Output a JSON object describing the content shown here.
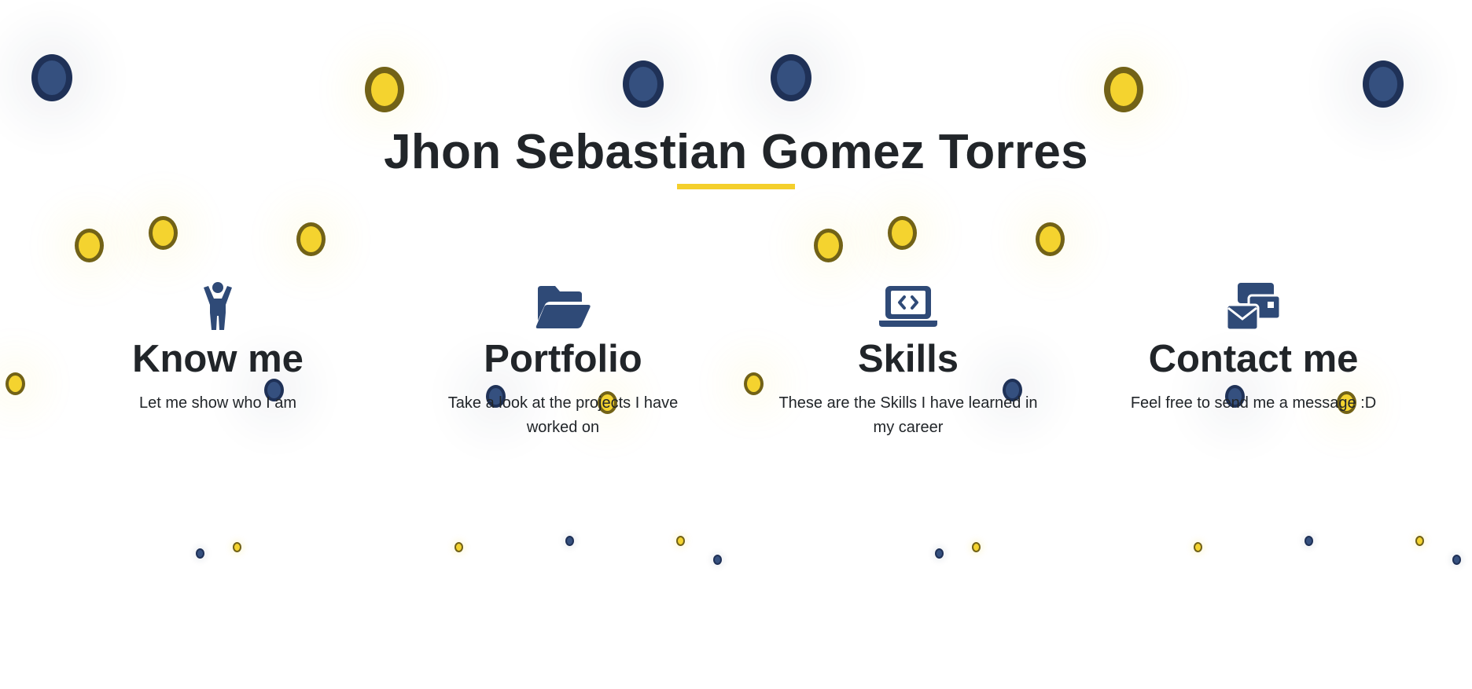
{
  "header": {
    "title": "Jhon Sebastian Gomez Torres"
  },
  "colors": {
    "accent": "#f4cf2c",
    "navy": "#2f4a77",
    "text": "#212529"
  },
  "sections": [
    {
      "icon": "person-icon",
      "title": "Know me",
      "description": "Let me show who I am"
    },
    {
      "icon": "folder-open-icon",
      "title": "Portfolio",
      "description": "Take a look at the projects I have worked on"
    },
    {
      "icon": "laptop-code-icon",
      "title": "Skills",
      "description": "These are the Skills I have learned in my career"
    },
    {
      "icon": "contact-envelope-icon",
      "title": "Contact me",
      "description": "Feel free to send me a message :D"
    }
  ]
}
